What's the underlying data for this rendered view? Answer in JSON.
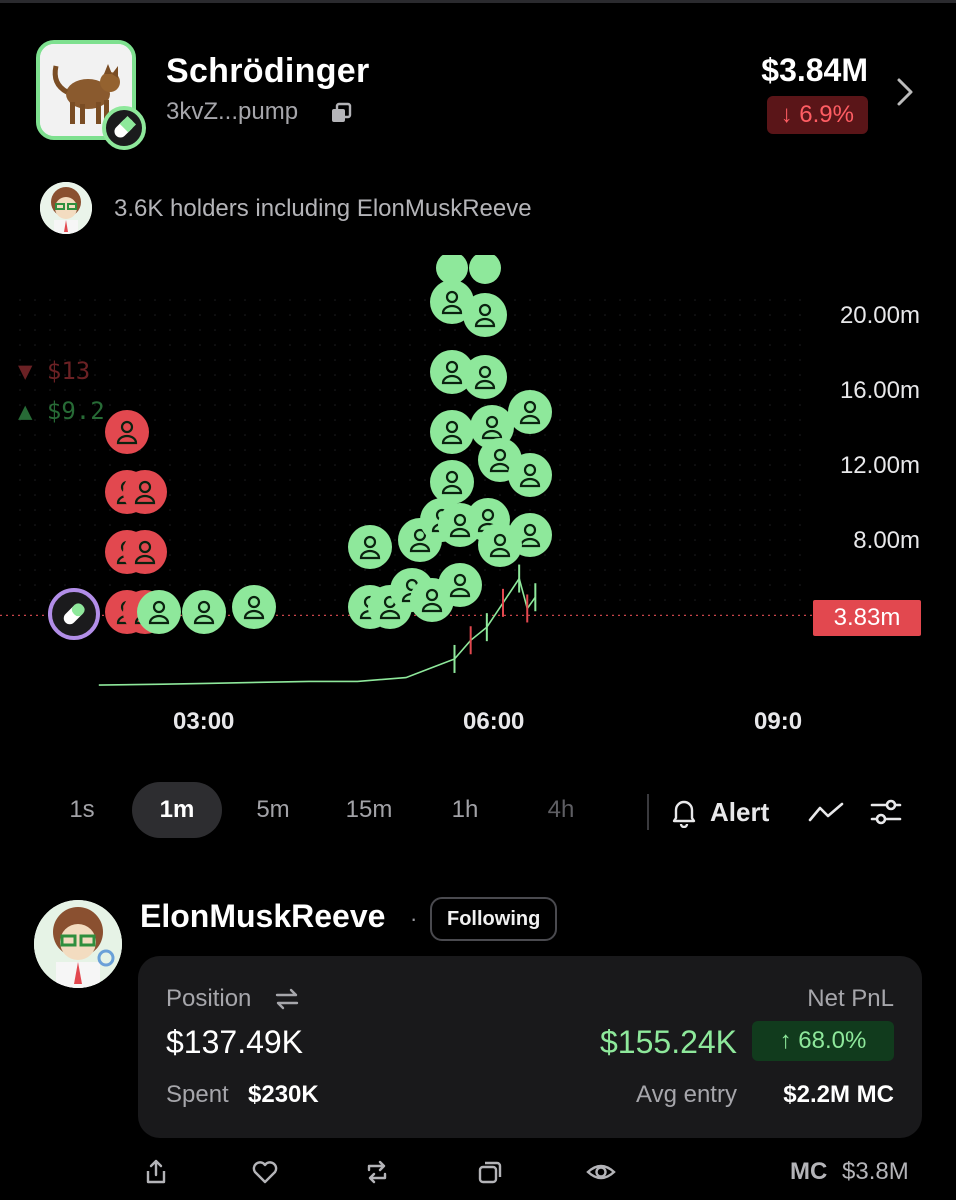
{
  "token": {
    "name": "Schrödinger",
    "address": "3kvZ...pump",
    "market_cap": "$3.84M",
    "change": "↓ 6.9%"
  },
  "holders": {
    "text": "3.6K holders including ElonMuskReeve"
  },
  "chart": {
    "price_labels": [
      "20.00m",
      "16.00m",
      "12.00m",
      "8.00m"
    ],
    "current_price": "3.83m",
    "time_labels": [
      "03:00",
      "06:00",
      "09:0"
    ],
    "left_labels": [
      "▼ $13",
      "▲ $9.2"
    ]
  },
  "chart_data": {
    "type": "line",
    "x": [
      "03:00",
      "06:00",
      "09:00"
    ],
    "ylabel": "",
    "ylim": [
      0,
      20
    ],
    "y_unit": "m",
    "current_value": 3.83,
    "series": [
      {
        "values_note": "",
        "x": [
          "01:50",
          "02:30",
          "03:00",
          "03:30",
          "04:00",
          "04:30",
          "05:00",
          "05:15",
          "05:30",
          "05:40",
          "05:50",
          "06:00",
          "06:10",
          "06:15",
          "06:20"
        ],
        "values": [
          0.1,
          0.15,
          0.2,
          0.25,
          0.3,
          0.3,
          0.5,
          1.0,
          1.5,
          2.5,
          3.2,
          4.5,
          5.8,
          4.2,
          4.8
        ]
      }
    ]
  },
  "timeframes": [
    {
      "label": "1s",
      "state": "normal"
    },
    {
      "label": "1m",
      "state": "active"
    },
    {
      "label": "5m",
      "state": "normal"
    },
    {
      "label": "15m",
      "state": "normal"
    },
    {
      "label": "1h",
      "state": "normal"
    },
    {
      "label": "4h",
      "state": "dim"
    }
  ],
  "toolbar": {
    "alert_label": "Alert"
  },
  "trader": {
    "name": "ElonMuskReeve",
    "separator": "·",
    "following_label": "Following",
    "position_label": "Position",
    "position_value": "$137.49K",
    "spent_label": "Spent",
    "spent_value": "$230K",
    "pnl_label": "Net PnL",
    "pnl_value": "$155.24K",
    "pnl_percent": "↑ 68.0%",
    "avg_entry_label": "Avg entry",
    "avg_entry_value": "$2.2M MC"
  },
  "bottom_bar": {
    "mc_label": "MC",
    "mc_value": "$3.8M"
  },
  "colors": {
    "green": "#8ee89b",
    "red": "#e2484f",
    "bg": "#000000"
  }
}
